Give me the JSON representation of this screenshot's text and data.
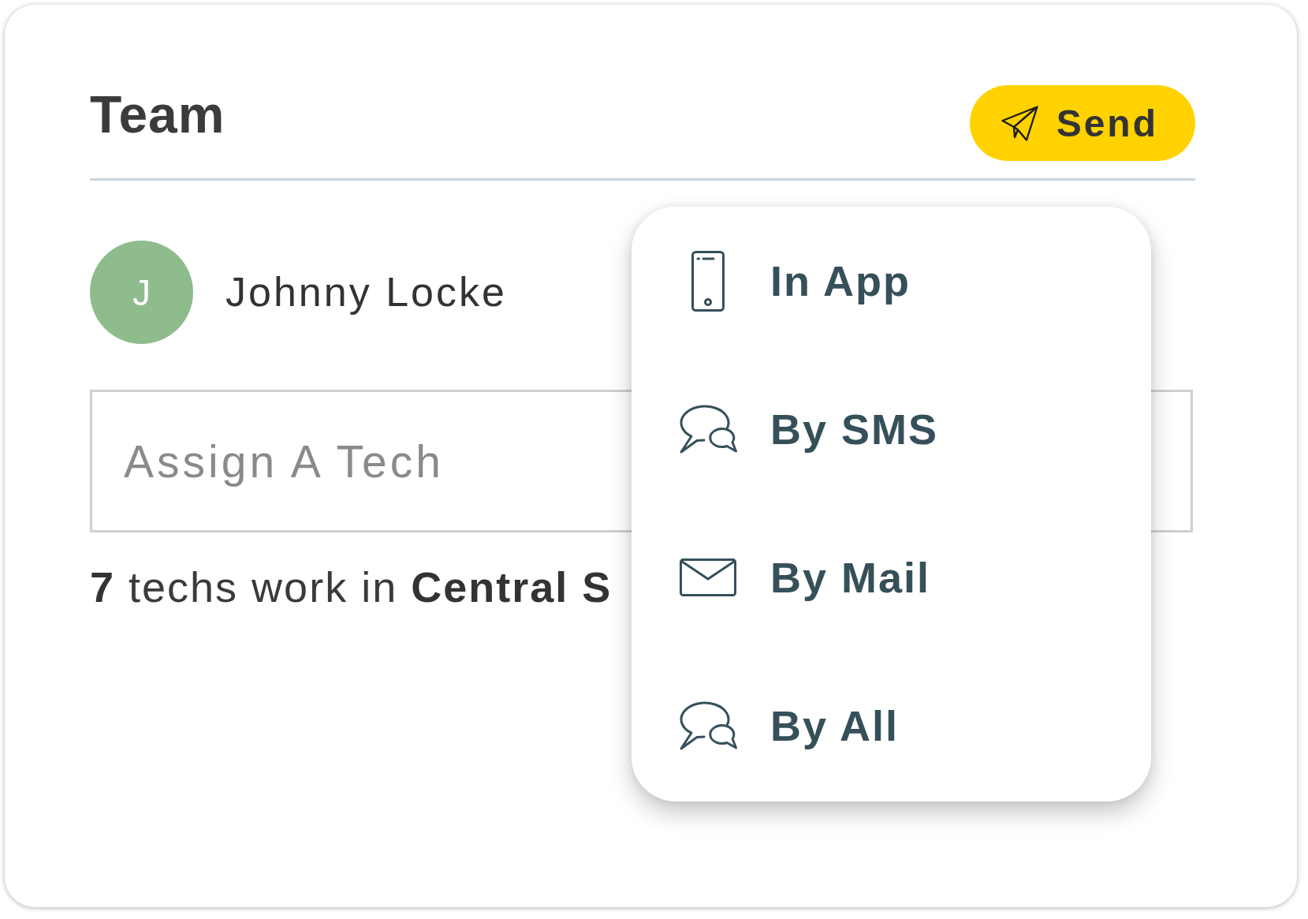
{
  "card": {
    "title": "Team",
    "send_button": {
      "label": "Send"
    },
    "member": {
      "initial": "J",
      "name": "Johnny Locke"
    },
    "assign_field": {
      "placeholder": "Assign A Tech"
    },
    "summary": "**7** techs work in **Central S**"
  },
  "send_menu": {
    "items": [
      {
        "kind": "app",
        "label": "In App"
      },
      {
        "kind": "sms",
        "label": "By SMS"
      },
      {
        "kind": "mail",
        "label": "By Mail"
      },
      {
        "kind": "all",
        "label": "By All"
      }
    ]
  }
}
